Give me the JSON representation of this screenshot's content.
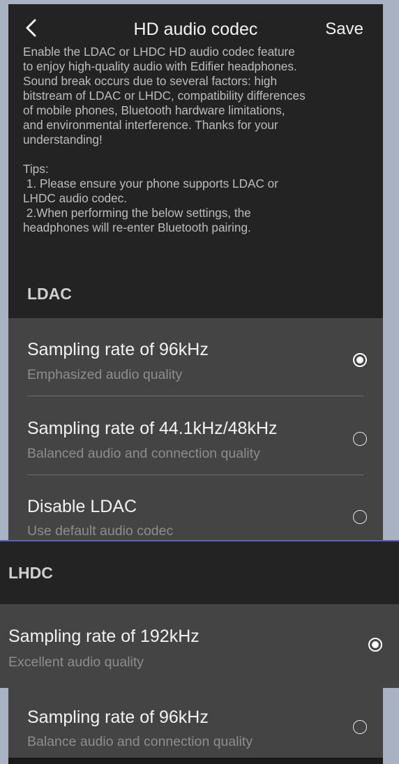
{
  "header": {
    "title": "HD audio codec",
    "save_label": "Save"
  },
  "description": {
    "paragraph": [
      "Enable the LDAC or LHDC HD audio codec feature",
      "to enjoy high-quality audio with Edifier headphones.",
      "Sound break occurs due to several factors: high",
      "bitstream of LDAC or LHDC, compatibility differences",
      "of mobile phones, Bluetooth hardware limitations,",
      "and environmental interference. Thanks for your",
      "understanding!"
    ],
    "tips": [
      "Tips:",
      " 1. Please ensure your phone supports LDAC or",
      "LHDC audio codec.",
      " 2.When performing the below settings, the",
      "headphones will re-enter Bluetooth pairing."
    ]
  },
  "ldac": {
    "section_label": "LDAC",
    "options": [
      {
        "title": "Sampling rate of 96kHz",
        "subtitle": "Emphasized audio quality",
        "selected": true
      },
      {
        "title": "Sampling rate of 44.1kHz/48kHz",
        "subtitle": "Balanced audio and connection quality",
        "selected": false
      },
      {
        "title": "Disable LDAC",
        "subtitle": "Use default audio codec",
        "selected": false
      }
    ]
  },
  "lhdc": {
    "section_label": "LHDC",
    "options": [
      {
        "title": "Sampling rate of 192kHz",
        "subtitle": "Excellent audio quality",
        "selected": true
      },
      {
        "title": "Sampling rate of 96kHz",
        "subtitle": "Balance audio and connection quality",
        "selected": false
      }
    ]
  },
  "colors": {
    "background": "#232323",
    "card": "#444444",
    "highlight_border": "#5b64b6",
    "page_border": "#a9b2c3"
  },
  "icons": {
    "back": "chevron-left-icon",
    "radio_selected": "radio-selected-icon",
    "radio_unselected": "radio-unselected-icon"
  }
}
